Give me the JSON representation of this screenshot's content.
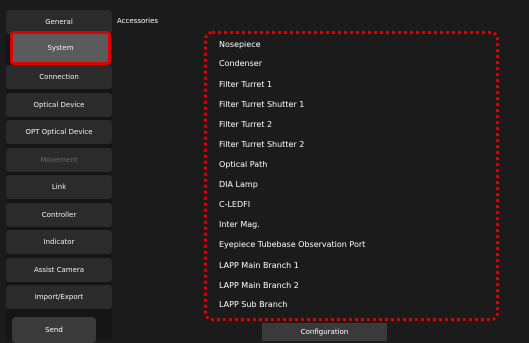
{
  "sidebar": {
    "items": [
      {
        "label": "General",
        "state": "normal"
      },
      {
        "label": "System",
        "state": "selected"
      },
      {
        "label": "Connection",
        "state": "normal"
      },
      {
        "label": "Optical Device",
        "state": "normal"
      },
      {
        "label": "OPT Optical Device",
        "state": "normal"
      },
      {
        "label": "Movement",
        "state": "disabled"
      },
      {
        "label": "Link",
        "state": "normal"
      },
      {
        "label": "Controller",
        "state": "normal"
      },
      {
        "label": "Indicator",
        "state": "normal"
      },
      {
        "label": "Assist Camera",
        "state": "normal"
      },
      {
        "label": "Import/Export",
        "state": "normal"
      }
    ],
    "send_label": "Send"
  },
  "main": {
    "section_title": "Accessories",
    "items": [
      "Nosepiece",
      "Condenser",
      "Filter Turret 1",
      "Filter Turret Shutter 1",
      "Filter Turret 2",
      "Filter Turret Shutter 2",
      "Optical Path",
      "DIA Lamp",
      "C-LEDFI",
      "Inter Mag.",
      "Eyepiece Tubebase Observation Port",
      "LAPP Main Branch 1",
      "LAPP Main Branch 2",
      "LAPP Sub Branch"
    ],
    "bottom_tab": "Configuration"
  },
  "colors": {
    "background": "#1b1b1b",
    "button": "#2b2b2b",
    "selected_button": "#5b5b5b",
    "highlight_red": "#e00000",
    "disabled_text": "#6a6a6a"
  }
}
